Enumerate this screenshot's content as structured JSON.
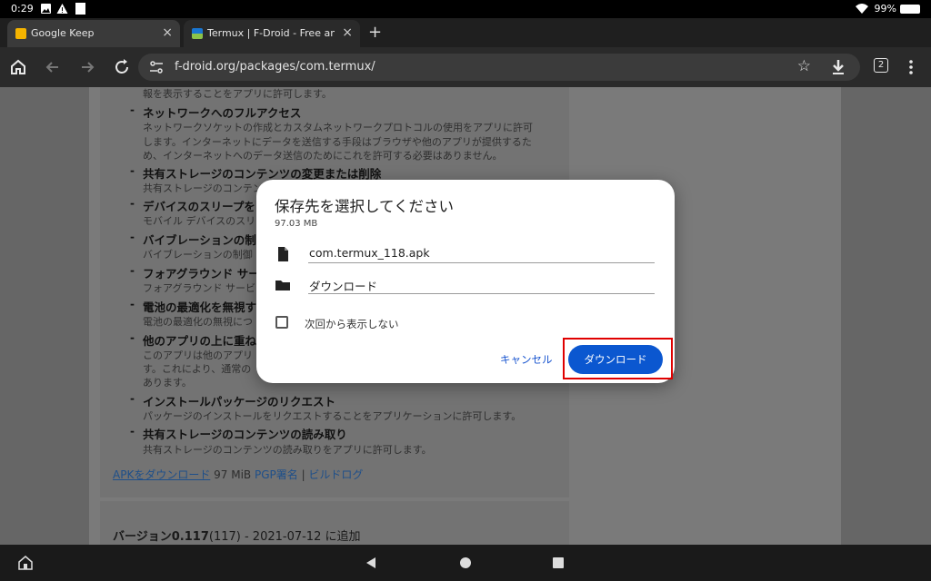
{
  "status": {
    "time": "0:29",
    "battery": "99%"
  },
  "tabs": [
    {
      "title": "Google Keep",
      "close": "×"
    },
    {
      "title": "Termux | F-Droid - Free and O",
      "close": "×"
    }
  ],
  "new_tab": "+",
  "toolbar": {
    "url": "f-droid.org/packages/com.termux/",
    "tab_count": "2"
  },
  "permissions": [
    {
      "title": "",
      "desc": [
        "報を表示することをアプリに許可します。"
      ]
    },
    {
      "title": "ネットワークへのフルアクセス",
      "desc": [
        "ネットワークソケットの作成とカスタムネットワークプロトコルの使用をアプリに許可",
        "します。インターネットにデータを送信する手段はブラウザや他のアプリが提供するた",
        "め、インターネットへのデータ送信のためにこれを許可する必要はありません。"
      ]
    },
    {
      "title": "共有ストレージのコンテンツの変更または削除",
      "desc": [
        "共有ストレージのコンテン"
      ]
    },
    {
      "title": "デバイスのスリープを",
      "desc": [
        "モバイル デバイスのスリ"
      ]
    },
    {
      "title": "バイブレーションの制",
      "desc": [
        "バイブレーションの制御"
      ]
    },
    {
      "title": "フォアグラウンド サー",
      "desc": [
        "フォアグラウンド サービ"
      ]
    },
    {
      "title": "電池の最適化を無視す",
      "desc": [
        "電池の最適化の無視につ"
      ]
    },
    {
      "title": "他のアプリの上に重ね",
      "desc": [
        "このアプリは他のアプリ",
        "す。これにより、通常の",
        "あります。"
      ]
    },
    {
      "title": "インストールパッケージのリクエスト",
      "desc": [
        "パッケージのインストールをリクエストすることをアプリケーションに許可します。"
      ]
    },
    {
      "title": "共有ストレージのコンテンツの読み取り",
      "desc": [
        "共有ストレージのコンテンツの読み取りをアプリに許可します。"
      ]
    }
  ],
  "links": {
    "apk": "APKをダウンロード",
    "size": " 97 MiB ",
    "pgp": "PGP署名",
    "sep": " | ",
    "build": "ビルドログ"
  },
  "version": {
    "label": "バージョン0.117",
    "code": "(117)",
    "date": " - 2021-07-12 に追加"
  },
  "dialog": {
    "title": "保存先を選択してください",
    "size": "97.03 MB",
    "filename": "com.termux_118.apk",
    "folder": "ダウンロード",
    "checkbox": "次回から表示しない",
    "cancel": "キャンセル",
    "download": "ダウンロード"
  },
  "colors": {
    "accent": "#0b57d0",
    "highlight": "#e00000"
  }
}
